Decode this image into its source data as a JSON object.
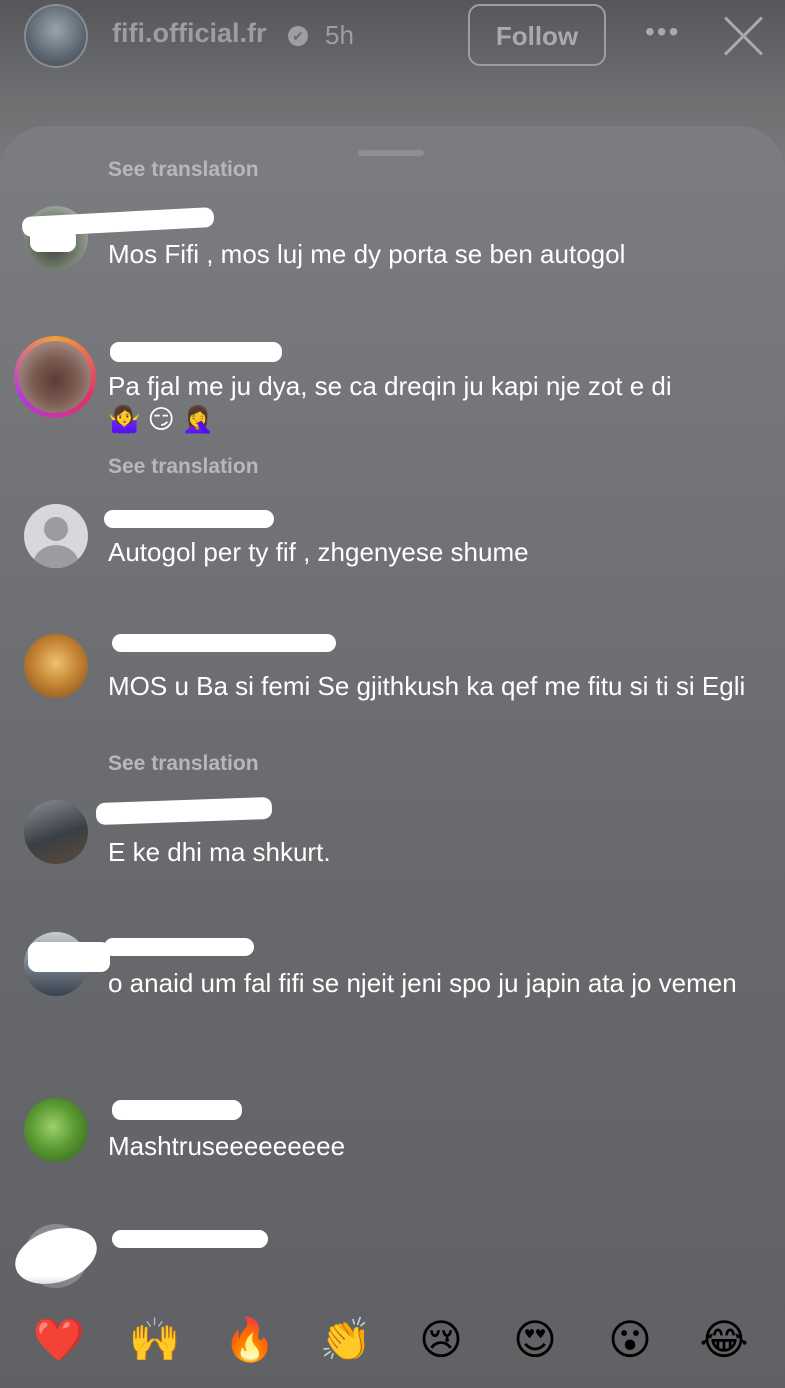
{
  "header": {
    "username": "fifi.official.fr",
    "verified_icon": "✔",
    "time": "5h",
    "follow_label": "Follow",
    "more_label": "•••"
  },
  "comments": [
    {
      "username": "",
      "text": "",
      "translate": "See translation"
    },
    {
      "username": "",
      "text": "Mos Fifi , mos luj me dy porta se ben autogol",
      "translate": ""
    },
    {
      "username": "",
      "text": "Pa fjal me ju dya, se ca dreqin ju kapi nje zot e di\n🤷‍♀️ 😏 🤦‍♀️",
      "translate": "See translation"
    },
    {
      "username": "",
      "text": "Autogol per ty fif , zhgenyese shume",
      "translate": ""
    },
    {
      "username": "",
      "text": "MOS u Ba si femi Se gjithkush ka qef me fitu si ti si  Egli",
      "translate": "See translation"
    },
    {
      "username": "",
      "text": "E ke dhi ma shkurt.",
      "translate": ""
    },
    {
      "username": "",
      "text": "o anaid um fal fifi se njeit jeni spo ju japin ata jo vemen",
      "translate": ""
    },
    {
      "username": "",
      "text": "Mashtruseeeeeeeee",
      "translate": ""
    },
    {
      "username": "",
      "text": "",
      "translate": ""
    }
  ],
  "reactions": [
    "❤️",
    "🙌",
    "🔥",
    "👏",
    "😢",
    "😍",
    "😮",
    "😂"
  ],
  "colors": {
    "sheet": "#717376",
    "text": "#ffffff",
    "muted": "#b7b8ba"
  }
}
